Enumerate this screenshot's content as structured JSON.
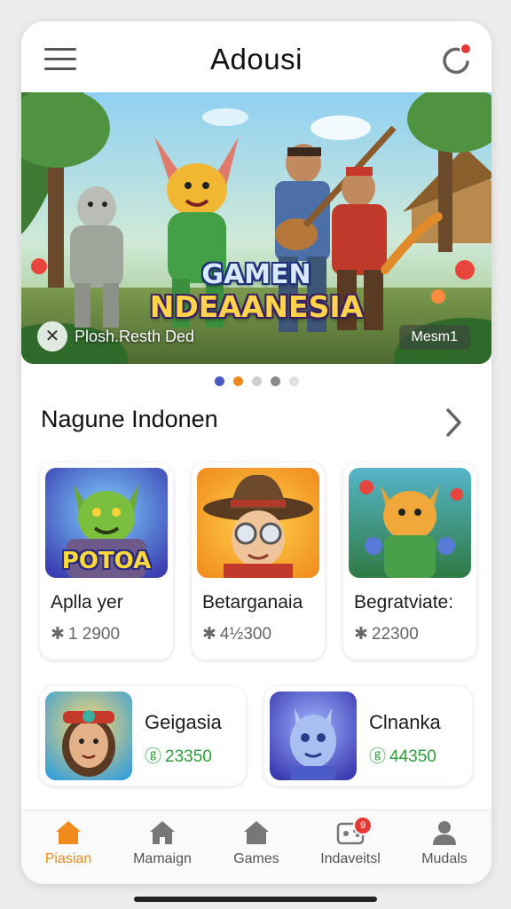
{
  "header": {
    "title": "Adousi",
    "menu_icon": "hamburger-menu-icon",
    "notification_icon": "refresh-notification-icon"
  },
  "banner": {
    "title_line1": "GAMEN",
    "title_line2": "NDEAANESIA",
    "caption": "Plosh.Resth Ded",
    "chip_label": "Mesm1",
    "close_icon": "close-icon",
    "slide_count": 5,
    "active_slide": 1
  },
  "section": {
    "title": "Nagune Indonen",
    "arrow_icon": "chevron-right-icon"
  },
  "featured_games": [
    {
      "name": "Aplla yer",
      "stat": "1 2900",
      "stat_icon": "puzzle-icon",
      "thumb_text": "POTOA"
    },
    {
      "name": "Betarganaia",
      "stat": "4½300",
      "stat_icon": "puzzle-icon"
    },
    {
      "name": "Begratviate:",
      "stat": "22300",
      "stat_icon": "puzzle-icon"
    }
  ],
  "more_games": [
    {
      "name": "Geigasia",
      "stat": "23350",
      "stat_icon": "download-icon"
    },
    {
      "name": "Clnanka",
      "stat": "44350",
      "stat_icon": "download-icon"
    }
  ],
  "bottom_nav": [
    {
      "label": "Piasian",
      "icon": "home-icon",
      "active": true
    },
    {
      "label": "Mamaign",
      "icon": "home-icon",
      "active": false
    },
    {
      "label": "Games",
      "icon": "home-icon",
      "active": false
    },
    {
      "label": "Indaveitsl",
      "icon": "gamepad-icon",
      "active": false,
      "badge": "9"
    },
    {
      "label": "Mudals",
      "icon": "person-icon",
      "active": false
    }
  ],
  "colors": {
    "accent": "#f08a1c",
    "dot_active": "#4a5bc6",
    "stat_green": "#2e9d3a",
    "badge_red": "#e53935"
  }
}
